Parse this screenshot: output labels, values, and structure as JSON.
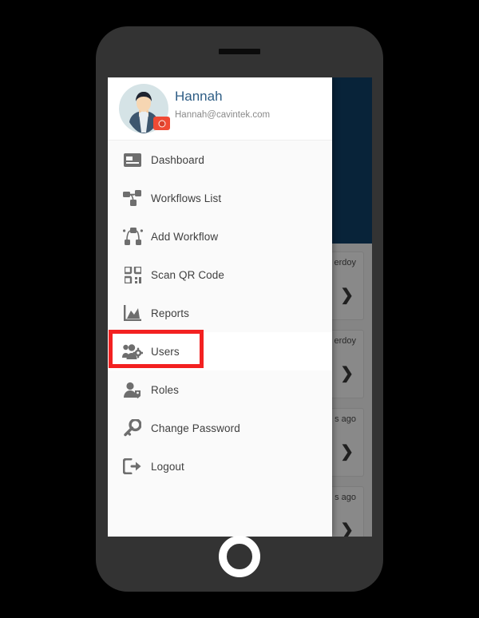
{
  "device": {
    "frame_color": "#333333",
    "speaker": "speaker-grille",
    "home_button": "home-button"
  },
  "drawer": {
    "profile": {
      "name": "Hannah",
      "email": "Hannah@cavintek.com",
      "name_color": "#2e5d85",
      "email_color": "#8a8a8a",
      "avatar_icon": "user-avatar",
      "badge_icon": "camera-icon",
      "badge_color": "#f04a34"
    },
    "items": [
      {
        "label": "Dashboard",
        "icon": "dashboard-icon",
        "selected": false
      },
      {
        "label": "Workflows List",
        "icon": "workflow-list-icon",
        "selected": false
      },
      {
        "label": "Add Workflow",
        "icon": "add-workflow-icon",
        "selected": false
      },
      {
        "label": "Scan QR Code",
        "icon": "qr-code-icon",
        "selected": false
      },
      {
        "label": "Reports",
        "icon": "reports-chart-icon",
        "selected": false
      },
      {
        "label": "Users",
        "icon": "users-gear-icon",
        "selected": true
      },
      {
        "label": "Roles",
        "icon": "role-tag-icon",
        "selected": false
      },
      {
        "label": "Change Password",
        "icon": "key-icon",
        "selected": false
      },
      {
        "label": "Logout",
        "icon": "logout-icon",
        "selected": false
      }
    ],
    "highlight": {
      "target": "Users",
      "color": "#f32121"
    }
  },
  "background_app": {
    "header_color": "#0f4068",
    "donut": {
      "percent_label": "%",
      "track_color": "#bdbdb8",
      "arc_color": "#2e7d1e"
    },
    "cards": [
      {
        "time": "erdoy",
        "chevron": "chevron-right-icon"
      },
      {
        "time": "erdoy",
        "chevron": "chevron-right-icon"
      },
      {
        "time": "s ago",
        "chevron": "chevron-right-icon"
      },
      {
        "time": "s ago",
        "chevron": "chevron-right-icon"
      }
    ]
  }
}
